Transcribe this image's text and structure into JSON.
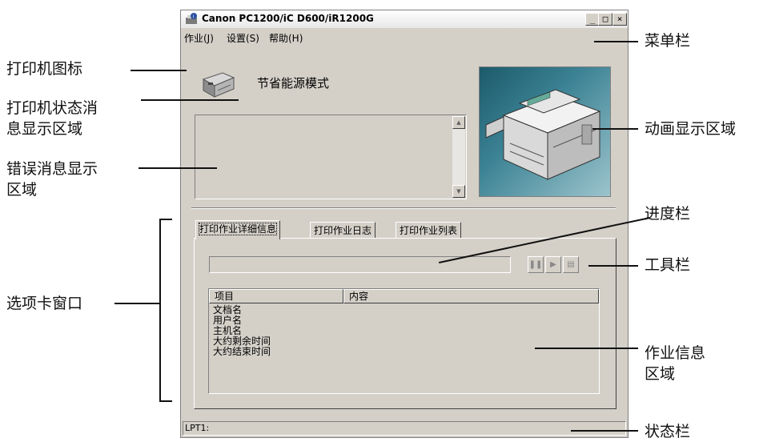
{
  "window": {
    "title": "Canon PC1200/iC D600/iR1200G",
    "minimize_label": "_",
    "maximize_label": "□",
    "close_label": "×"
  },
  "menu": {
    "items": [
      {
        "label": "作业(J)"
      },
      {
        "label": "设置(S)"
      },
      {
        "label": "帮助(H)"
      }
    ]
  },
  "printer_status": {
    "message": "节省能源模式"
  },
  "tabs": [
    {
      "label": "打印作业详细信息",
      "active": true
    },
    {
      "label": "打印作业日志",
      "active": false
    },
    {
      "label": "打印作业列表",
      "active": false
    }
  ],
  "job_list": {
    "columns": [
      "项目",
      "内容"
    ],
    "rows": [
      "文档名",
      "用户名",
      "主机名",
      "大约剩余时间",
      "大约结束时间"
    ]
  },
  "status_bar": {
    "text": "LPT1:"
  },
  "callouts": {
    "menu_bar": "菜单栏",
    "printer_icon": "打印机图标",
    "status_area_line1": "打印机状态消",
    "status_area_line2": "息显示区域",
    "animation_area": "动画显示区域",
    "error_area_line1": "错误消息显示",
    "error_area_line2": "区域",
    "progress_bar": "进度栏",
    "toolbar": "工具栏",
    "tab_window": "选项卡窗口",
    "job_info_line1": "作业信息",
    "job_info_line2": "区域",
    "status_bar": "状态栏"
  }
}
